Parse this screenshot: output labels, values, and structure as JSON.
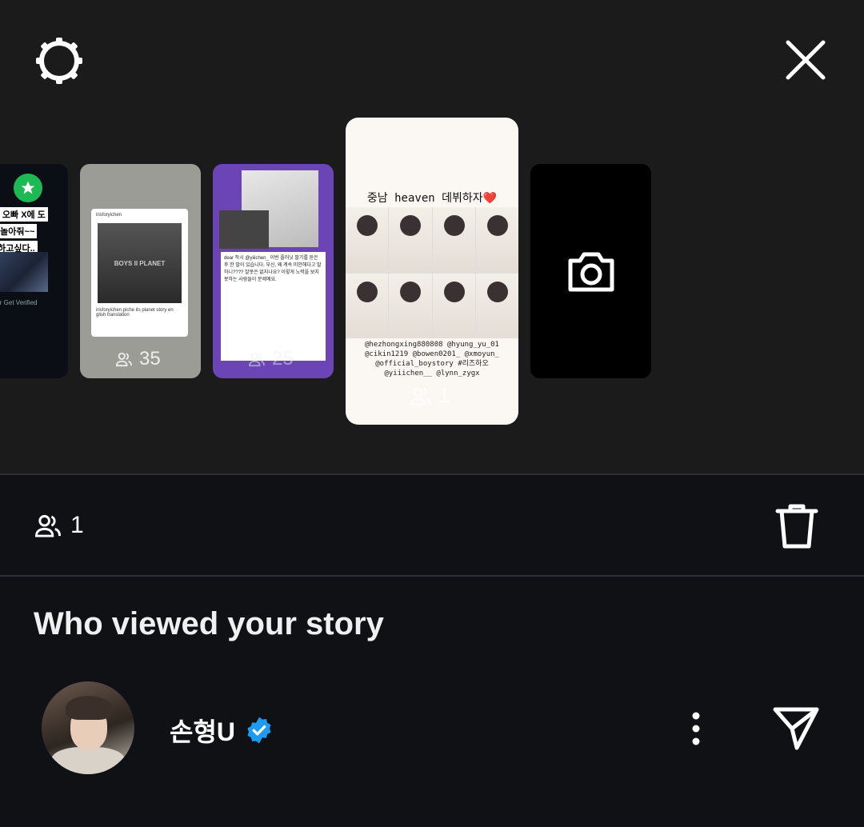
{
  "top": {
    "settings_icon": "settings-icon",
    "close_icon": "close-icon"
  },
  "thumbnails": [
    {
      "id": "story-1",
      "preview_lines": [
        "n_ 오빠 X에 도",
        "께 놀아줘~~",
        "친하고싶다.."
      ],
      "preview_snippet": "nager  Get Verified",
      "badge": "star-icon"
    },
    {
      "id": "story-2",
      "preview_header": "irisforyichen",
      "preview_caption": "irisforyichen piche its planet story en glish translation",
      "preview_logo": "BOYS II PLANET",
      "views": "35"
    },
    {
      "id": "story-3",
      "preview_text": "dear 작시 @yiiichen_ 이번 플러닛 팔기를 듣은 후 한 말이 있습니다. 부신, 왜 계속 미안해다고 말하니???? 잘못은 없지나요? 이렇게 노력을 보지 못하는 사람들이 문제예요.",
      "views": "25"
    },
    {
      "id": "story-4",
      "title": "중남 heaven 데뷔하자❤️",
      "tags": "@hezhongxing880808 @hyung_yu_01 @cikin1219 @bowen0201_ @xmoyun_ @official_boystory #리즈하오 @yiiichen__ @lynn_zygx",
      "views": "1",
      "selected": true
    },
    {
      "id": "story-5",
      "type": "add-story",
      "icon": "camera-icon"
    }
  ],
  "detail": {
    "views": "1",
    "views_icon": "people-icon",
    "delete_icon": "trash-icon"
  },
  "viewers": {
    "heading": "Who viewed your story",
    "list": [
      {
        "name": "손형U",
        "verified": true
      }
    ]
  },
  "colors": {
    "top_bg": "#1b1b1c",
    "bottom_bg": "#0f1115",
    "verified": "#1d9bf0",
    "accent_purple": "#6b45b5"
  }
}
